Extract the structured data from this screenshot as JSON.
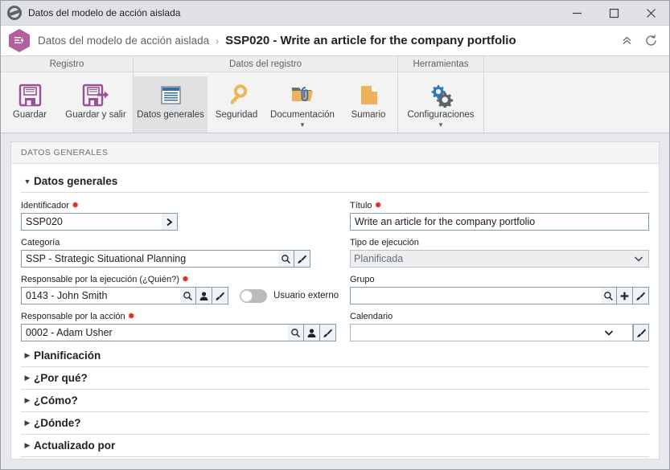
{
  "window": {
    "title": "Datos del modelo de acción aislada",
    "icon": "globe-icon",
    "controls": {
      "minimize": "minimize-icon",
      "maximize": "maximize-icon",
      "close": "close-icon"
    }
  },
  "header": {
    "app_icon": "hexagon-action-icon",
    "breadcrumb_root": "Datos del modelo de acción aislada",
    "breadcrumb_separator": "›",
    "breadcrumb_current": "SSP020 - Write an article for the company portfolio",
    "collapse_icon": "double-chevron-up-icon",
    "refresh_icon": "refresh-icon"
  },
  "ribbon": {
    "groups": [
      {
        "title": "Registro",
        "items": [
          {
            "label": "Guardar",
            "icon": "save-icon",
            "selected": false,
            "has_caret": false
          },
          {
            "label": "Guardar y salir",
            "icon": "save-and-exit-icon",
            "selected": false,
            "has_caret": false
          }
        ]
      },
      {
        "title": "Datos del registro",
        "items": [
          {
            "label": "Datos generales",
            "icon": "general-data-icon",
            "selected": true,
            "has_caret": false
          },
          {
            "label": "Seguridad",
            "icon": "key-icon",
            "selected": false,
            "has_caret": false
          },
          {
            "label": "Documentación",
            "icon": "folder-attachment-icon",
            "selected": false,
            "has_caret": true
          },
          {
            "label": "Sumario",
            "icon": "document-icon",
            "selected": false,
            "has_caret": false
          }
        ]
      },
      {
        "title": "Herramientas",
        "items": [
          {
            "label": "Configuraciones",
            "icon": "gears-icon",
            "selected": false,
            "has_caret": true
          }
        ]
      }
    ]
  },
  "panel": {
    "header": "DATOS GENERALES",
    "section": {
      "title": "Datos generales",
      "expanded": true,
      "toggle_icon": "triangle-down-icon"
    }
  },
  "fields": {
    "identificador": {
      "label": "Identificador",
      "required": true,
      "value": "SSP020",
      "placeholder": "",
      "button_icon": "chevron-right-icon"
    },
    "titulo": {
      "label": "Título",
      "required": true,
      "value": "Write an article for the company portfolio",
      "placeholder": ""
    },
    "categoria": {
      "label": "Categoría",
      "required": false,
      "value": "SSP - Strategic Situational Planning",
      "placeholder": "",
      "buttons": [
        "search-icon",
        "brush-icon"
      ]
    },
    "tipo_ejecucion": {
      "label": "Tipo de ejecución",
      "required": false,
      "value": "Planificada",
      "disabled": true,
      "options": [
        "Planificada"
      ],
      "chevron_icon": "chevron-down-icon"
    },
    "responsable_ejecucion": {
      "label": "Responsable por la ejecución (¿Quién?)",
      "required": true,
      "value": "0143 - John Smith",
      "placeholder": "",
      "buttons": [
        "search-icon",
        "person-icon",
        "brush-icon"
      ]
    },
    "usuario_externo": {
      "label": "Usuario externo",
      "checked": false
    },
    "grupo": {
      "label": "Grupo",
      "required": false,
      "value": "",
      "placeholder": "",
      "buttons": [
        "search-icon",
        "plus-icon",
        "brush-icon"
      ]
    },
    "responsable_accion": {
      "label": "Responsable por la acción",
      "required": true,
      "value": "0002 - Adam Usher",
      "placeholder": "",
      "buttons": [
        "search-icon",
        "person-icon",
        "brush-icon"
      ]
    },
    "calendario": {
      "label": "Calendario",
      "required": false,
      "value": "",
      "options": [
        ""
      ],
      "chevron_icon": "chevron-down-icon",
      "buttons": [
        "brush-icon"
      ]
    }
  },
  "collapsed_sections": [
    {
      "title": "Planificación",
      "toggle_icon": "triangle-right-icon"
    },
    {
      "title": "¿Por qué?",
      "toggle_icon": "triangle-right-icon"
    },
    {
      "title": "¿Cómo?",
      "toggle_icon": "triangle-right-icon"
    },
    {
      "title": "¿Dónde?",
      "toggle_icon": "triangle-right-icon"
    },
    {
      "title": "Actualizado por",
      "toggle_icon": "triangle-right-icon"
    }
  ],
  "colors": {
    "accent_purple": "#9b4f96",
    "brand_hex": "#b0609b",
    "required_red": "#d93025",
    "field_border": "#7f9bb0",
    "ribbon_bg": "#f3f3f3",
    "content_bg": "#e7e9ec"
  }
}
